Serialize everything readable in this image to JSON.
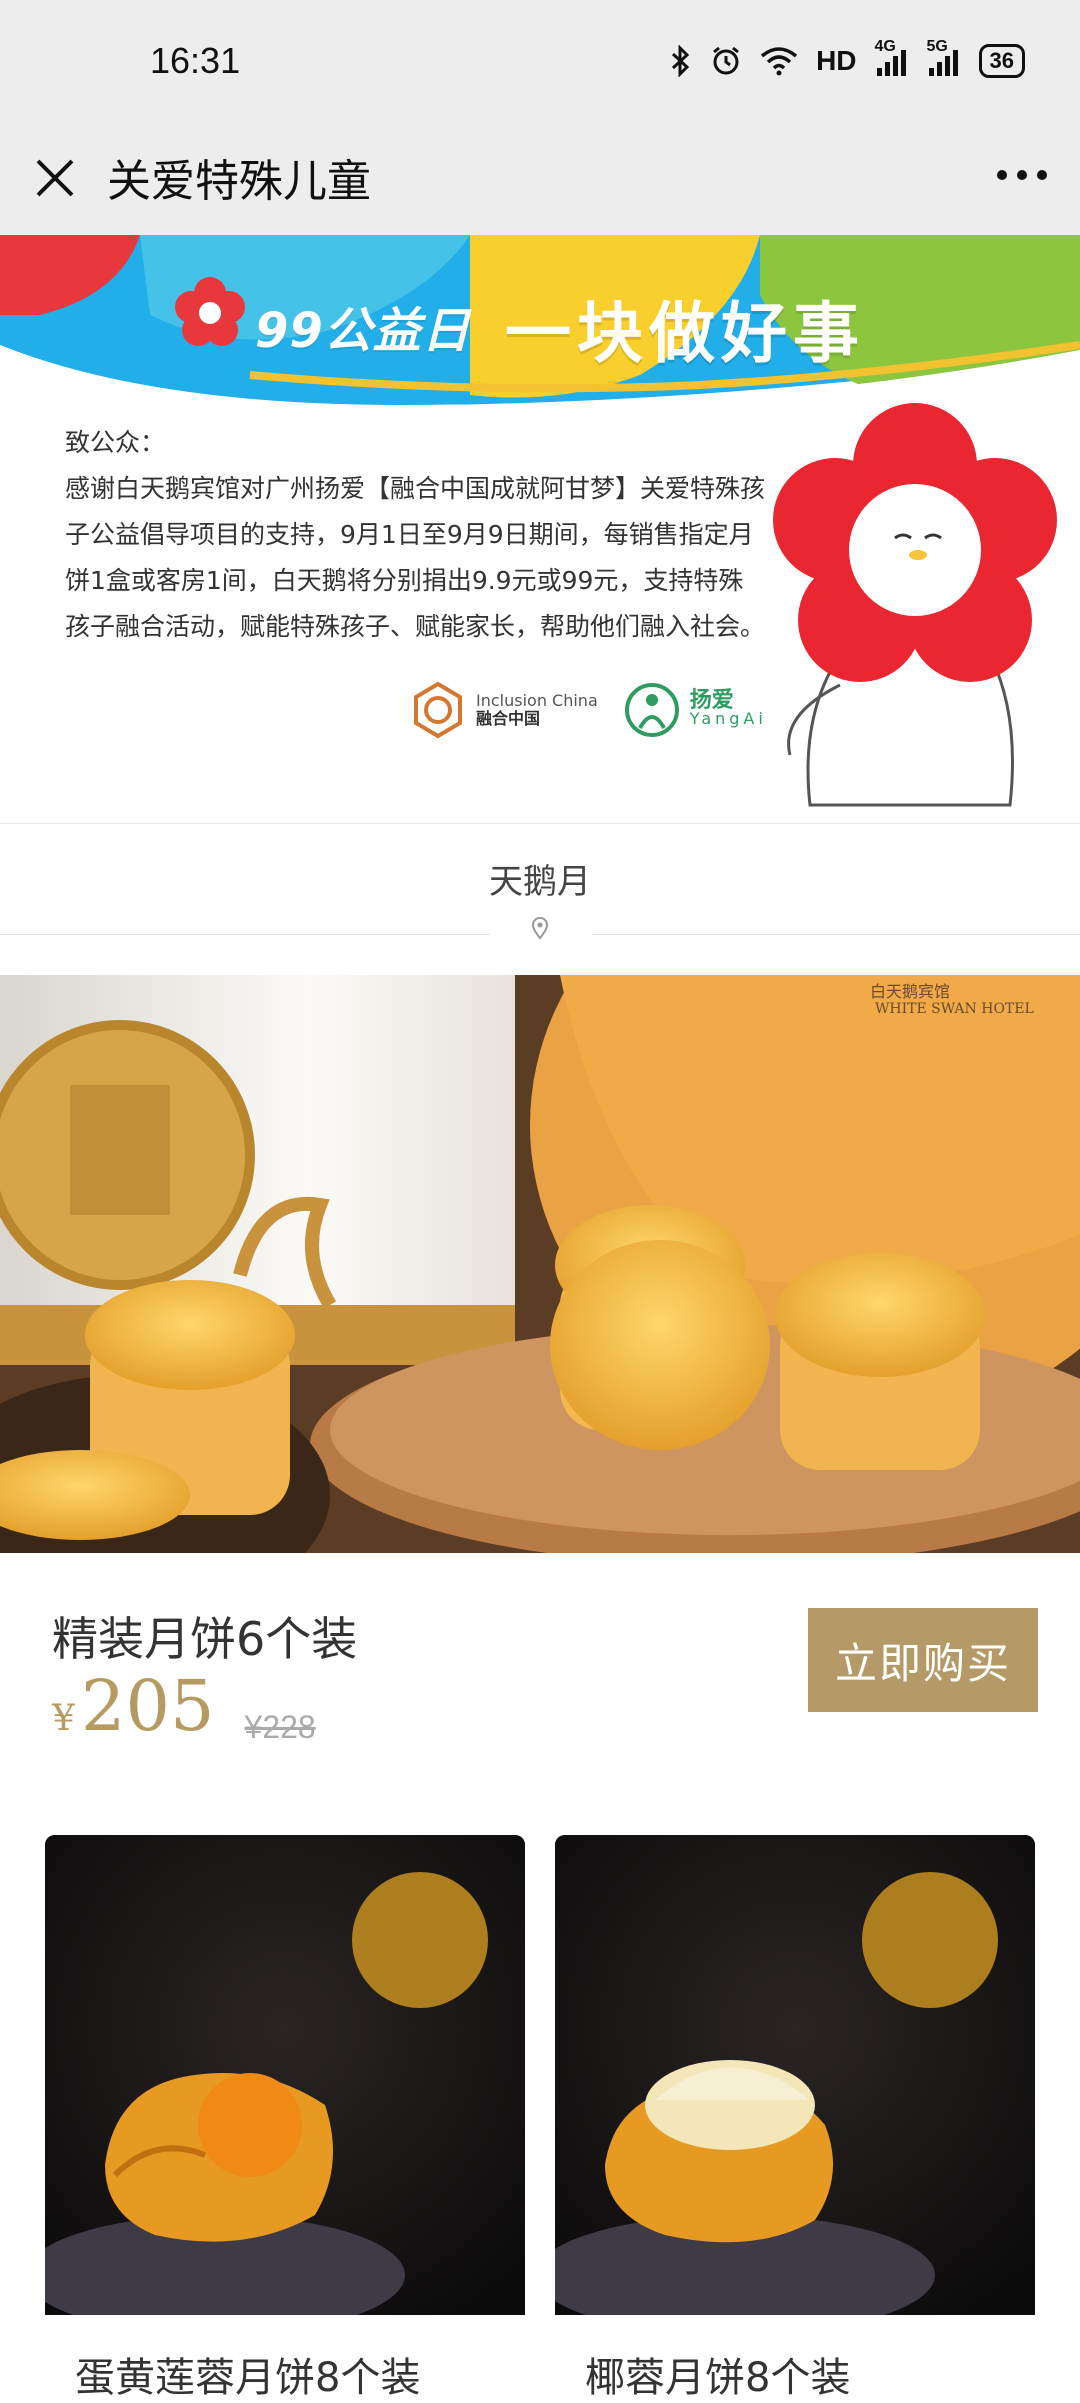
{
  "status_bar": {
    "time": "16:31",
    "network_label": "HD",
    "net4g": "4G",
    "net5g": "5G",
    "battery": "36"
  },
  "nav": {
    "title": "关爱特殊儿童"
  },
  "banner": {
    "logo_text": "99公益日",
    "slogan": "一块做好事",
    "greeting": "致公众：",
    "body": "感谢白天鹅宾馆对广州扬爱【融合中国成就阿甘梦】关爱特殊孩子公益倡导项目的支持，9月1日至9月9日期间，每销售指定月饼1盒或客房1间，白天鹅将分别捐出9.9元或99元，支持特殊孩子融合活动，赋能特殊孩子、赋能家长，帮助他们融入社会。",
    "partner1": "融合中国",
    "partner1_en": "Inclusion China",
    "partner2": "扬爱",
    "partner2_en": "YangAi"
  },
  "section": {
    "title": "天鹅月"
  },
  "hero": {
    "box_label": "白天鹅宾馆",
    "box_label_en": "WHITE SWAN HOTEL"
  },
  "product": {
    "name": "精装月饼6个装",
    "currency": "¥",
    "price": "205",
    "original_price": "¥228",
    "buy_label": "立即购买"
  },
  "grid": [
    {
      "name": "蛋黄莲蓉月饼8个装"
    },
    {
      "name": "椰蓉月饼8个装"
    }
  ],
  "colors": {
    "accent_gold": "#b39a66",
    "status_bg": "#ededed"
  }
}
